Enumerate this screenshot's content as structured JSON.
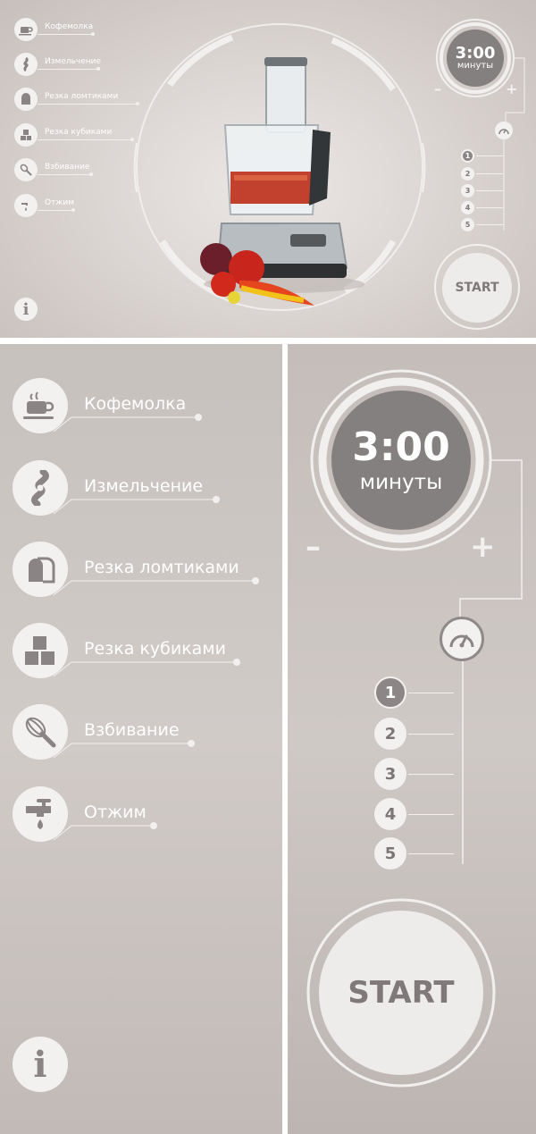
{
  "menu": {
    "items": [
      {
        "id": "coffee",
        "label": "Кофемолка",
        "icon": "coffee-cup-icon"
      },
      {
        "id": "grind",
        "label": "Измельчение",
        "icon": "blade-icon"
      },
      {
        "id": "slice",
        "label": "Резка ломтиками",
        "icon": "bread-slice-icon"
      },
      {
        "id": "dice",
        "label": "Резка кубиками",
        "icon": "cubes-icon"
      },
      {
        "id": "whisk",
        "label": "Взбивание",
        "icon": "whisk-icon"
      },
      {
        "id": "juice",
        "label": "Отжим",
        "icon": "juice-tap-icon"
      }
    ]
  },
  "timer": {
    "time": "3:00",
    "unit": "минуты",
    "minus": "–",
    "plus": "+"
  },
  "speed": {
    "icon": "speedometer-icon",
    "levels": [
      "1",
      "2",
      "3",
      "4",
      "5"
    ],
    "selected": "1"
  },
  "start_label": "START",
  "info_label": "i",
  "colors": {
    "background": "#d4cecb",
    "accent": "#858080",
    "light": "#f3f1f0",
    "divider": "#ffffff"
  }
}
